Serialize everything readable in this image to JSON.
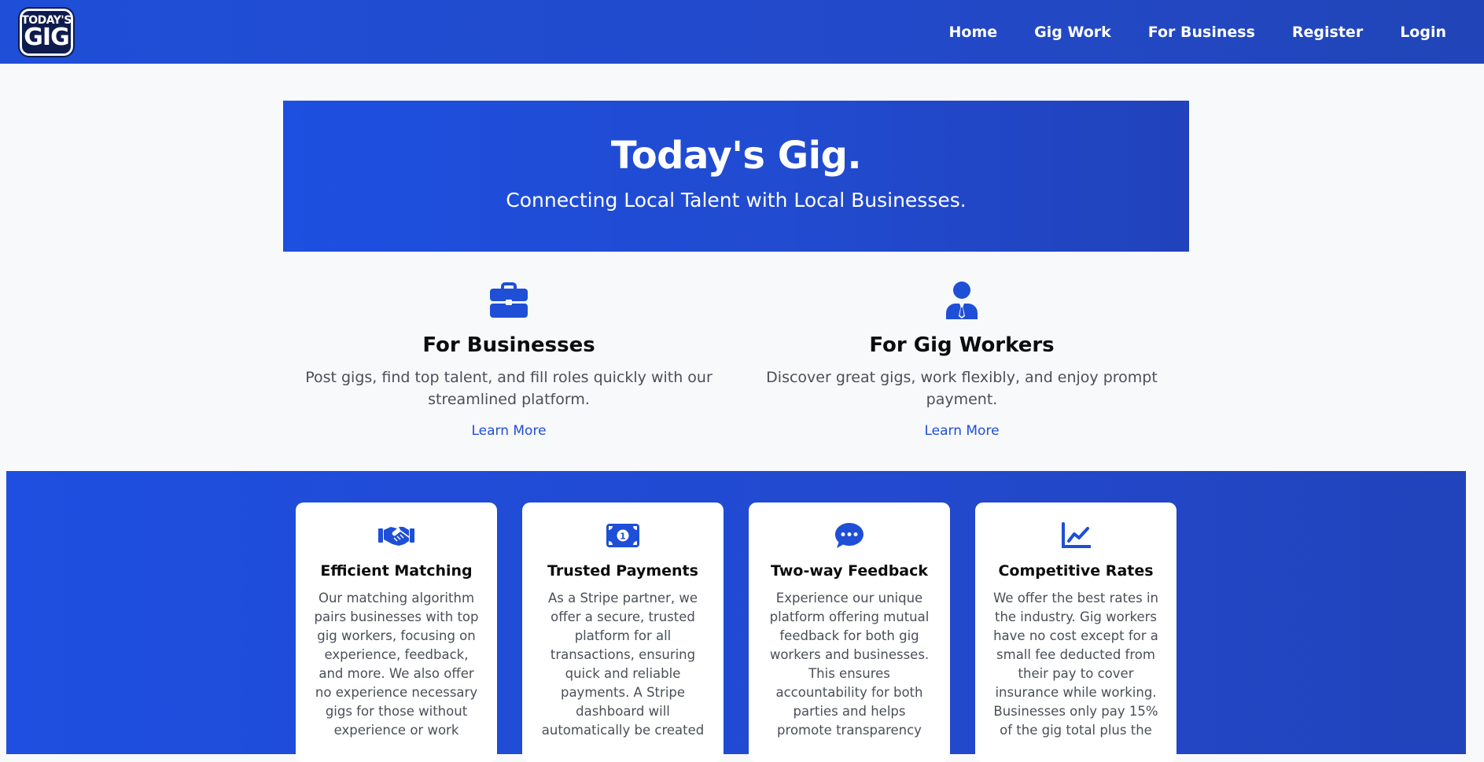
{
  "logo": {
    "line1": "TODAY'S",
    "line2": "GIG"
  },
  "nav": {
    "items": [
      {
        "label": "Home"
      },
      {
        "label": "Gig Work"
      },
      {
        "label": "For Business"
      },
      {
        "label": "Register"
      },
      {
        "label": "Login"
      }
    ]
  },
  "hero": {
    "title": "Today's Gig.",
    "subtitle": "Connecting Local Talent with Local Businesses."
  },
  "audience": {
    "business": {
      "icon": "briefcase-icon",
      "title": "For Businesses",
      "description": "Post gigs, find top talent, and fill roles quickly with our streamlined platform.",
      "link": "Learn More"
    },
    "workers": {
      "icon": "user-tie-icon",
      "title": "For Gig Workers",
      "description": "Discover great gigs, work flexibly, and enjoy prompt payment.",
      "link": "Learn More"
    }
  },
  "features": [
    {
      "icon": "handshake-icon",
      "title": "Efficient Matching",
      "description": "Our matching algorithm pairs businesses with top gig workers, focusing on experience, feedback, and more. We also offer no experience necessary gigs for those without experience or work"
    },
    {
      "icon": "money-bill-icon",
      "title": "Trusted Payments",
      "description": "As a Stripe partner, we offer a secure, trusted platform for all transactions, ensuring quick and reliable payments. A Stripe dashboard will automatically be created"
    },
    {
      "icon": "comment-dots-icon",
      "title": "Two-way Feedback",
      "description": "Experience our unique platform offering mutual feedback for both gig workers and businesses. This ensures accountability for both parties and helps promote transparency"
    },
    {
      "icon": "chart-line-icon",
      "title": "Competitive Rates",
      "description": "We offer the best rates in the industry. Gig workers have no cost except for a small fee deducted from their pay to cover insurance while working. Businesses only pay 15% of the gig total plus the"
    }
  ],
  "colors": {
    "brand_blue": "#1f4fd8",
    "logo_navy": "#0e1b4d",
    "body_text": "#4a4f57",
    "background": "#f8f9fb"
  }
}
